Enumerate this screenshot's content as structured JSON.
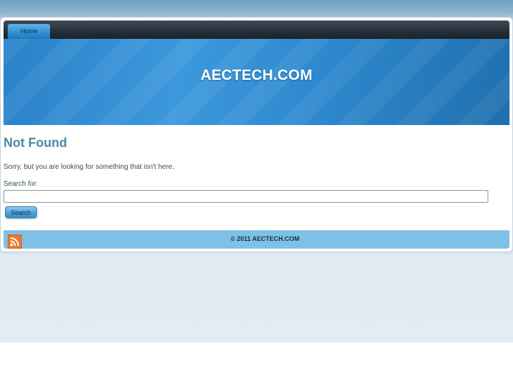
{
  "nav": {
    "items": [
      {
        "label": "Home"
      }
    ]
  },
  "header": {
    "site_title": "AECTECH.COM"
  },
  "main": {
    "heading": "Not Found",
    "message": "Sorry, but you are looking for something that isn't here.",
    "search": {
      "label": "Search for:",
      "value": "",
      "button_label": "Search"
    }
  },
  "footer": {
    "feed_icon": "rss-icon",
    "copyright": "© 2011 AECTECH.COM"
  },
  "colors": {
    "heading": "#4f86a6",
    "banner": "#3c98dc",
    "footer": "#7fc1e6",
    "rss": "#e9772c"
  }
}
